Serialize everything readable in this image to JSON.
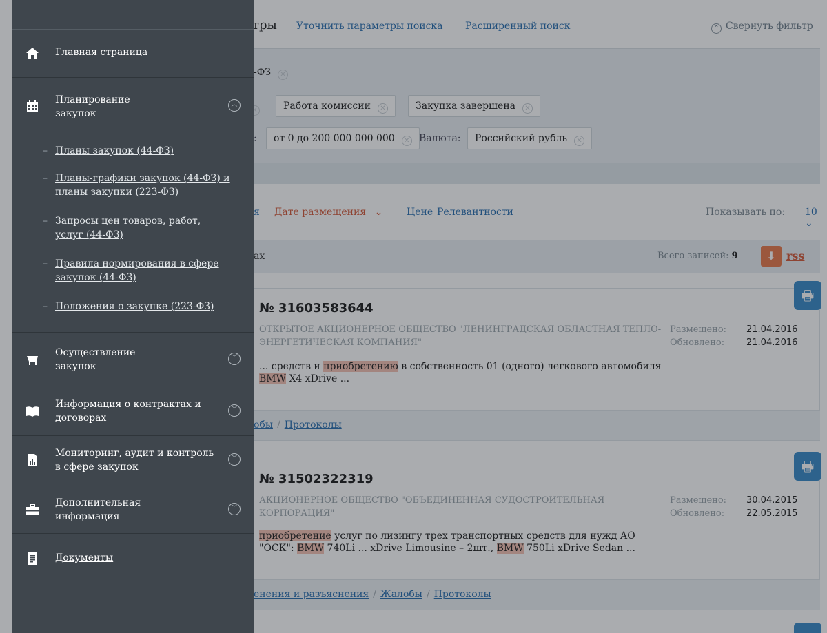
{
  "filter": {
    "title_partial": "тры",
    "refine_link": "Уточнить параметры поиска",
    "advanced_link": "Расширенный поиск",
    "collapse_label": "Свернуть фильтр",
    "law_chip": "-ФЗ",
    "status_chips": [
      "Работа комиссии",
      "Закупка завершена"
    ],
    "price_label_partial": ":",
    "price_chip": "от 0 до 200 000 000 000",
    "currency_label": "Валюта:",
    "currency_chip": "Российский рубль"
  },
  "sort": {
    "partial_prefix": "я",
    "selected": "Дате размещения",
    "price": "Цене",
    "relevance": "Релевантности",
    "show_by_label": "Показывать по:",
    "show_by_value": "10"
  },
  "summary": {
    "label_partial": "ах",
    "total_label": "Всего записей:",
    "total_value": "9",
    "rss": "rss"
  },
  "records": [
    {
      "number": "№ 31603583644",
      "org": "ОТКРЫТОЕ АКЦИОНЕРНОЕ ОБЩЕСТВО \"ЛЕНИНГРАДСКАЯ ОБЛАСТНАЯ ТЕПЛО-ЭНЕРГЕТИЧЕСКАЯ КОМПАНИЯ\"",
      "placed_label": "Размещено:",
      "placed": "21.04.2016",
      "updated_label": "Обновлено:",
      "updated": "21.04.2016",
      "desc_a": "... средств и ",
      "desc_hl1": "приобретению",
      "desc_b": " в собственность 01 (одного) легкового автомобиля ",
      "desc_hl2": "BMW",
      "desc_c": " X4 xDrive ...",
      "foot_a": "обы",
      "foot_b": "Протоколы"
    },
    {
      "number": "№ 31502322319",
      "org": "АКЦИОНЕРНОЕ ОБЩЕСТВО \"ОБЪЕДИНЕННАЯ СУДОСТРОИТЕЛЬНАЯ КОРПОРАЦИЯ\"",
      "placed_label": "Размещено:",
      "placed": "30.04.2015",
      "updated_label": "Обновлено:",
      "updated": "22.05.2015",
      "desc_hl1": "приобретение",
      "desc_a": " услуг по лизингу трех транспортных средств для нужд АО \"ОСК\": ",
      "desc_hl2": "BMW",
      "desc_b": " 740Li ... xDrive Limousine – 2шт., ",
      "desc_hl3": "BMW",
      "desc_c": " 750Li xDrive Sedan ...",
      "foot_a": "енения и разъяснения",
      "foot_b": "Жалобы",
      "foot_c": "Протоколы"
    }
  ],
  "menu": {
    "home": "Главная страница",
    "planning": "Планирование закупок",
    "planning_items": [
      "Планы закупок (44-ФЗ)",
      "Планы-графики закупок (44-ФЗ) и планы закупки (223-ФЗ)",
      "Запросы цен товаров, работ, услуг (44-ФЗ)",
      "Правила нормирования в сфере закупок (44-ФЗ)",
      "Положения о закупке (223-ФЗ)"
    ],
    "procurement": "Осуществление закупок",
    "contracts": "Информация о контрактах и договорах",
    "monitoring": "Мониторинг, аудит и контроль в сфере закупок",
    "additional": "Дополнительная информация",
    "documents": "Документы"
  }
}
